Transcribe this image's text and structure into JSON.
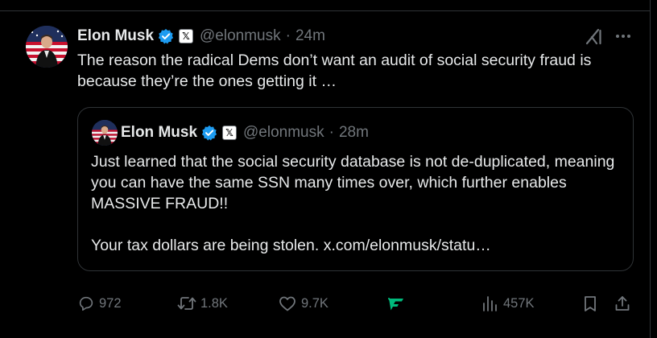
{
  "tweet": {
    "author_name": "Elon Musk",
    "handle": "@elonmusk",
    "separator": "·",
    "time": "24m",
    "text": "The reason the radical Dems don’t want an audit of social security fraud is because they’re the ones getting it …",
    "affiliate_badge": "𝕏"
  },
  "quote": {
    "author_name": "Elon Musk",
    "handle": "@elonmusk",
    "separator": "·",
    "time": "28m",
    "affiliate_badge": "𝕏",
    "paragraph1": "Just learned that the social security database is not de-duplicated, meaning you can have the same SSN many times over, which further enables MASSIVE FRAUD!!",
    "paragraph2": "Your tax dollars are being stolen. x.com/elonmusk/statu…"
  },
  "actions": {
    "replies": "972",
    "reposts": "1.8K",
    "likes": "9.7K",
    "views": "457K"
  },
  "icons": {
    "verified": "verified-badge-icon",
    "grok": "grok-icon",
    "more": "more-icon",
    "reply": "reply-icon",
    "repost": "repost-icon",
    "like": "heart-icon",
    "analytics": "views-icon",
    "bookmark": "bookmark-icon",
    "share": "share-icon",
    "grok_action": "grok-action-icon"
  },
  "colors": {
    "background": "#000000",
    "text": "#e7e9ea",
    "muted": "#71767b",
    "border": "#2f3336",
    "verified_blue": "#1d9bf0",
    "grok_green": "#00ba7c"
  }
}
